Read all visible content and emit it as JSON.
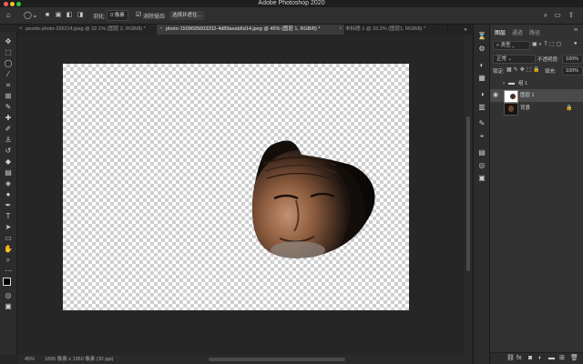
{
  "app": {
    "title": "Adobe Photoshop 2020"
  },
  "options_bar": {
    "feather_label": "羽化:",
    "feather_value": "0 像素",
    "antialias_label": "消除锯齿",
    "select_mask_label": "选择并遮住..."
  },
  "tabs": [
    {
      "label": "pexels-photo-236214.jpeg @ 32.1% (图层 2, RGB/8) *",
      "active": false
    },
    {
      "label": "photo-1509695603202-4d89aeab6d14.jpeg @ 45% (图层 1, RGB/8) *",
      "active": true
    },
    {
      "label": "未标题-1 @ 33.3% (图层1, RGB/8) *",
      "active": false
    }
  ],
  "status_bar": {
    "zoom": "45%",
    "doc_info": "1895 像素 x 1350 像素 (72 ppi)"
  },
  "layers_panel": {
    "tabs": [
      "图层",
      "通道",
      "路径"
    ],
    "filter_label": "类型",
    "blend_mode": "正常",
    "opacity_label": "不透明度:",
    "opacity_value": "100%",
    "lock_label": "锁定:",
    "fill_label": "填充:",
    "fill_value": "100%",
    "layers": [
      {
        "name": "组 1",
        "type": "group"
      },
      {
        "name": "图层 1",
        "type": "layer",
        "active": true
      },
      {
        "name": "背景",
        "type": "background"
      }
    ]
  },
  "colors": {
    "bg_dark": "#262626",
    "panel": "#323232",
    "active_layer": "#4a4a4a"
  }
}
